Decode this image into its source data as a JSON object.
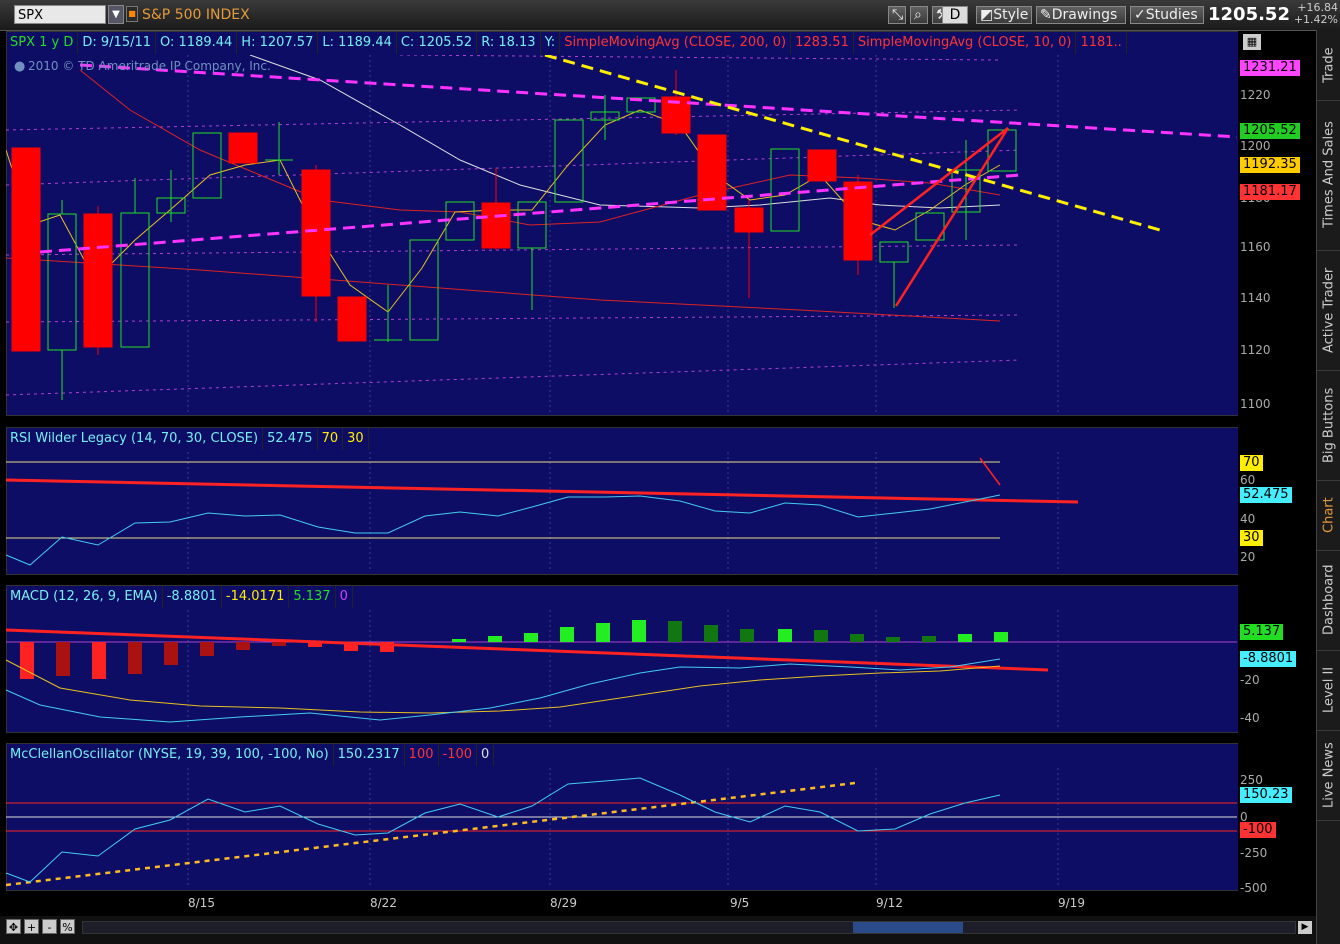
{
  "toolbar": {
    "symbol": "SPX",
    "symbol_name": "S&P 500 INDEX",
    "buttons": [
      "D",
      "Style",
      "Drawings",
      "Studies"
    ],
    "price": "1205.52",
    "change_pts": "+16.84",
    "change_pct": "+1.42%"
  },
  "sidebar": {
    "tabs": [
      "Trade",
      "Times And Sales",
      "Active Trader",
      "Big Buttons",
      "Chart",
      "Dashboard",
      "Level II",
      "Live News"
    ]
  },
  "price_panel": {
    "header": [
      "SPX 1 y D",
      "D: 9/15/11",
      "O: 1189.44",
      "H: 1207.57",
      "L: 1189.44",
      "C: 1205.52",
      "R: 18.13",
      "Y:",
      "SimpleMovingAvg (CLOSE, 200, 0)",
      "1283.51",
      "SimpleMovingAvg (CLOSE, 10, 0)",
      "1181.."
    ],
    "copyright": "2010 © TD Ameritrade IP Company, Inc.",
    "ticks": [
      "1220",
      "1200",
      "1180",
      "1160",
      "1140",
      "1120",
      "1100"
    ],
    "tags": [
      {
        "text": "1231.21",
        "color": "#ff44ff"
      },
      {
        "text": "1205.52",
        "color": "#22cc22"
      },
      {
        "text": "1192.35",
        "color": "#ffcc00"
      },
      {
        "text": "1181.17",
        "color": "#ff3333"
      }
    ]
  },
  "rsi_panel": {
    "header": [
      "RSI Wilder Legacy (14, 70, 30, CLOSE)",
      "52.475",
      "70",
      "30"
    ],
    "ticks": [
      "60",
      "40",
      "20"
    ],
    "tags": [
      {
        "text": "70",
        "color": "#ffee00"
      },
      {
        "text": "52.475",
        "color": "#44eeff"
      },
      {
        "text": "30",
        "color": "#ffee00"
      }
    ]
  },
  "macd_panel": {
    "header": [
      "MACD (12, 26, 9, EMA)",
      "-8.8801",
      "-14.0171",
      "5.137",
      "0"
    ],
    "ticks": [
      "-20",
      "-40"
    ],
    "tags": [
      {
        "text": "5.137",
        "color": "#22dd22"
      },
      {
        "text": "-8.8801",
        "color": "#44eeff"
      }
    ]
  },
  "mcc_panel": {
    "header": [
      "McClellanOscillator (NYSE, 19, 39, 100, -100, No)",
      "150.2317",
      "100",
      "-100",
      "0"
    ],
    "ticks": [
      "250",
      "0",
      "-250",
      "-500"
    ],
    "tags": [
      {
        "text": "150.23",
        "color": "#44eeff"
      },
      {
        "text": "-100",
        "color": "#ff3333"
      }
    ]
  },
  "dates": [
    "8/15",
    "8/22",
    "8/29",
    "9/5",
    "9/12",
    "9/19"
  ],
  "bottom": {
    "buttons": [
      "+",
      "-",
      "%"
    ]
  }
}
